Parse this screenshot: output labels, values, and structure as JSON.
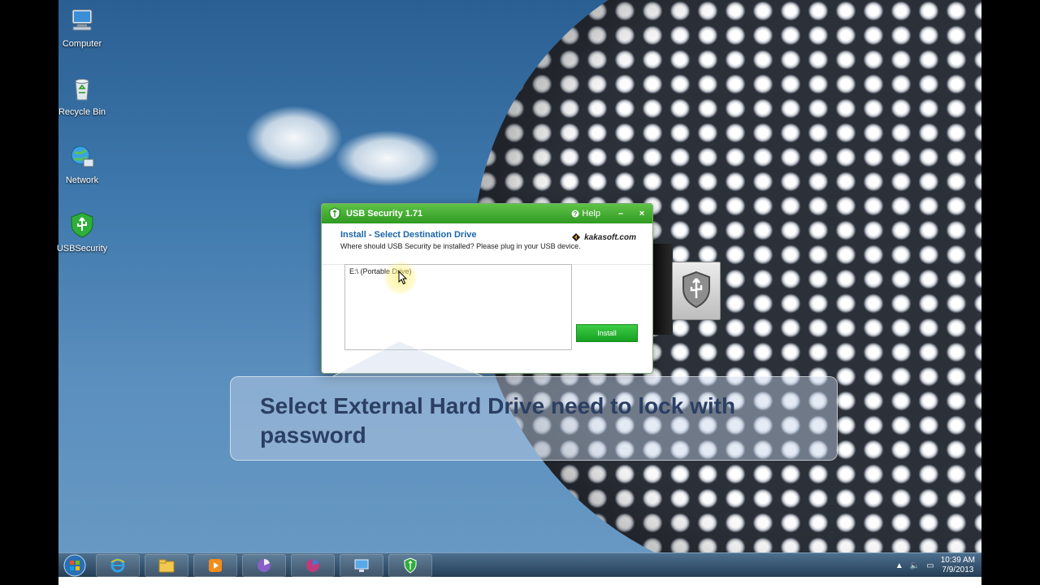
{
  "desktop": {
    "icons": [
      {
        "label": "Computer",
        "icon": "computer-icon"
      },
      {
        "label": "Recycle Bin",
        "icon": "recycle-bin-icon"
      },
      {
        "label": "Network",
        "icon": "network-icon"
      },
      {
        "label": "USBSecurity",
        "icon": "usb-security-shield-icon"
      }
    ]
  },
  "window": {
    "title": "USB Security 1.71",
    "help_label": "Help",
    "minimize_glyph": "–",
    "close_glyph": "×",
    "heading": "Install - Select Destination Drive",
    "subheading": "Where should USB Security be installed? Please plug in your USB device.",
    "brand": "kakasoft.com",
    "drives": [
      "E:\\ (Portable Drive)"
    ],
    "install_label": "Install",
    "accent_color": "#2f9a22"
  },
  "callout": {
    "text": "Select External Hard Drive need to lock with password"
  },
  "taskbar": {
    "items": [
      "internet-explorer-icon",
      "folder-icon",
      "media-player-icon",
      "app-icon",
      "app-icon",
      "remote-desktop-icon",
      "usb-security-shield-icon"
    ],
    "clock_time": "10:39 AM",
    "clock_date": "7/9/2013"
  }
}
